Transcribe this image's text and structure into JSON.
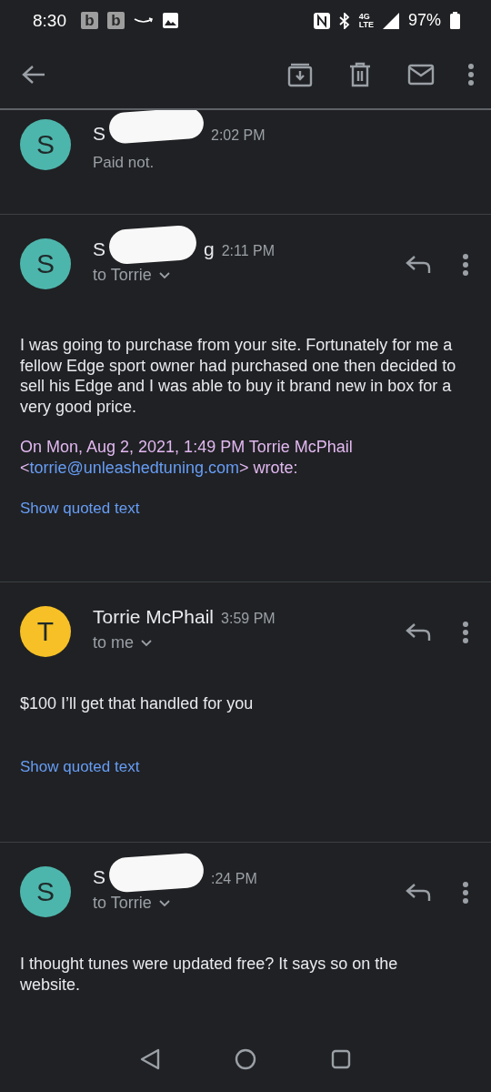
{
  "status_bar": {
    "time": "8:30",
    "app_badges": [
      "b",
      "b"
    ],
    "network_top": "4G",
    "network_bottom": "LTE",
    "battery": "97%"
  },
  "messages": [
    {
      "kind": "collapsed",
      "avatar": {
        "letter": "S",
        "color": "#4db6ac"
      },
      "sender": "S",
      "redacted": true,
      "time": "2:02 PM",
      "snippet": "Paid not."
    },
    {
      "kind": "expanded",
      "avatar": {
        "letter": "S",
        "color": "#4db6ac"
      },
      "sender": "S",
      "sender_tail": "g",
      "redacted": true,
      "time": "2:11 PM",
      "recipient": "to Torrie",
      "body": [
        "I was going to purchase from your site. Fortunately for me a fellow Edge sport owner had purchased one then decided to sell his Edge and I was able to buy it brand new in box for a very good price."
      ],
      "quote": {
        "prefix": "On Mon, Aug 2, 2021, 1:49 PM Torrie McPhail",
        "open": "<",
        "email": "torrie@unleashedtuning.com",
        "suffix": "> wrote:"
      },
      "show_quoted": "Show quoted text"
    },
    {
      "kind": "expanded",
      "avatar": {
        "letter": "T",
        "color": "#f6c026"
      },
      "sender": "Torrie McPhail",
      "redacted": false,
      "time": "3:59 PM",
      "recipient": "to me",
      "body": [
        "$100 I’ll get that handled for you"
      ],
      "show_quoted": "Show quoted text"
    },
    {
      "kind": "expanded",
      "avatar": {
        "letter": "S",
        "color": "#4db6ac"
      },
      "sender": "S",
      "redacted": true,
      "time": ":24 PM",
      "recipient": "to Torrie",
      "body": [
        "I thought tunes were updated free? It says so on the website."
      ]
    }
  ]
}
